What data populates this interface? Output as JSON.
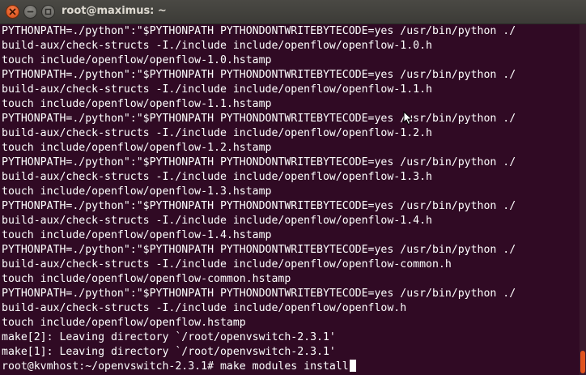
{
  "window": {
    "title": "root@maximus: ~",
    "close_icon": "close-icon",
    "minimize_icon": "minimize-icon",
    "maximize_icon": "maximize-icon"
  },
  "terminal": {
    "lines": [
      "PYTHONPATH=./python\":\"$PYTHONPATH PYTHONDONTWRITEBYTECODE=yes /usr/bin/python ./",
      "build-aux/check-structs -I./include include/openflow/openflow-1.0.h",
      "touch include/openflow/openflow-1.0.hstamp",
      "PYTHONPATH=./python\":\"$PYTHONPATH PYTHONDONTWRITEBYTECODE=yes /usr/bin/python ./",
      "build-aux/check-structs -I./include include/openflow/openflow-1.1.h",
      "touch include/openflow/openflow-1.1.hstamp",
      "PYTHONPATH=./python\":\"$PYTHONPATH PYTHONDONTWRITEBYTECODE=yes /usr/bin/python ./",
      "build-aux/check-structs -I./include include/openflow/openflow-1.2.h",
      "touch include/openflow/openflow-1.2.hstamp",
      "PYTHONPATH=./python\":\"$PYTHONPATH PYTHONDONTWRITEBYTECODE=yes /usr/bin/python ./",
      "build-aux/check-structs -I./include include/openflow/openflow-1.3.h",
      "touch include/openflow/openflow-1.3.hstamp",
      "PYTHONPATH=./python\":\"$PYTHONPATH PYTHONDONTWRITEBYTECODE=yes /usr/bin/python ./",
      "build-aux/check-structs -I./include include/openflow/openflow-1.4.h",
      "touch include/openflow/openflow-1.4.hstamp",
      "PYTHONPATH=./python\":\"$PYTHONPATH PYTHONDONTWRITEBYTECODE=yes /usr/bin/python ./",
      "build-aux/check-structs -I./include include/openflow/openflow-common.h",
      "touch include/openflow/openflow-common.hstamp",
      "PYTHONPATH=./python\":\"$PYTHONPATH PYTHONDONTWRITEBYTECODE=yes /usr/bin/python ./",
      "build-aux/check-structs -I./include include/openflow/openflow.h",
      "touch include/openflow/openflow.hstamp",
      "make[2]: Leaving directory `/root/openvswitch-2.3.1'",
      "make[1]: Leaving directory `/root/openvswitch-2.3.1'"
    ],
    "prompt": "root@kvmhost:~/openvswitch-2.3.1# ",
    "command": "make modules install"
  },
  "colors": {
    "background": "#300a24",
    "text": "#ffffff",
    "titlebar": "#3c3b37",
    "close_button": "#e0531f"
  }
}
